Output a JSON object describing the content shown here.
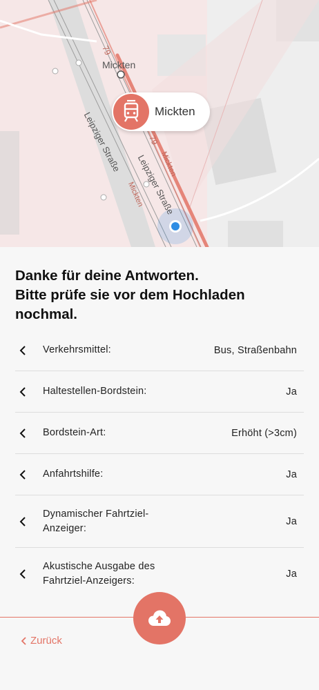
{
  "map": {
    "stop_name_label": "Mickten",
    "street_labels": [
      "Leipziger Straße",
      "Leipziger Straße"
    ],
    "rail_labels": [
      "Mickten",
      "Mickten"
    ],
    "line_labels": [
      "79",
      "79"
    ],
    "accent_color": "#e37466",
    "location_color": "#2f8de4"
  },
  "stop_bubble": {
    "name": "Mickten",
    "icon": "tram-icon"
  },
  "summary": {
    "heading": "Danke für deine Antworten.\nBitte prüfe sie vor dem Hochladen\nnochmal.",
    "rows": [
      {
        "label": "Verkehrsmittel:",
        "value": "Bus, Straßenbahn"
      },
      {
        "label": "Haltestellen-Bordstein:",
        "value": "Ja"
      },
      {
        "label": "Bordstein-Art:",
        "value": "Erhöht (>3cm)"
      },
      {
        "label": "Anfahrtshilfe:",
        "value": "Ja"
      },
      {
        "label": "Dynamischer Fahrtziel-\nAnzeiger:",
        "value": "Ja"
      },
      {
        "label": "Akustische Ausgabe des\nFahrtziel-Anzeigers:",
        "value": "Ja"
      }
    ]
  },
  "footer": {
    "upload_icon": "cloud-upload-icon",
    "back_label": "Zurück"
  }
}
